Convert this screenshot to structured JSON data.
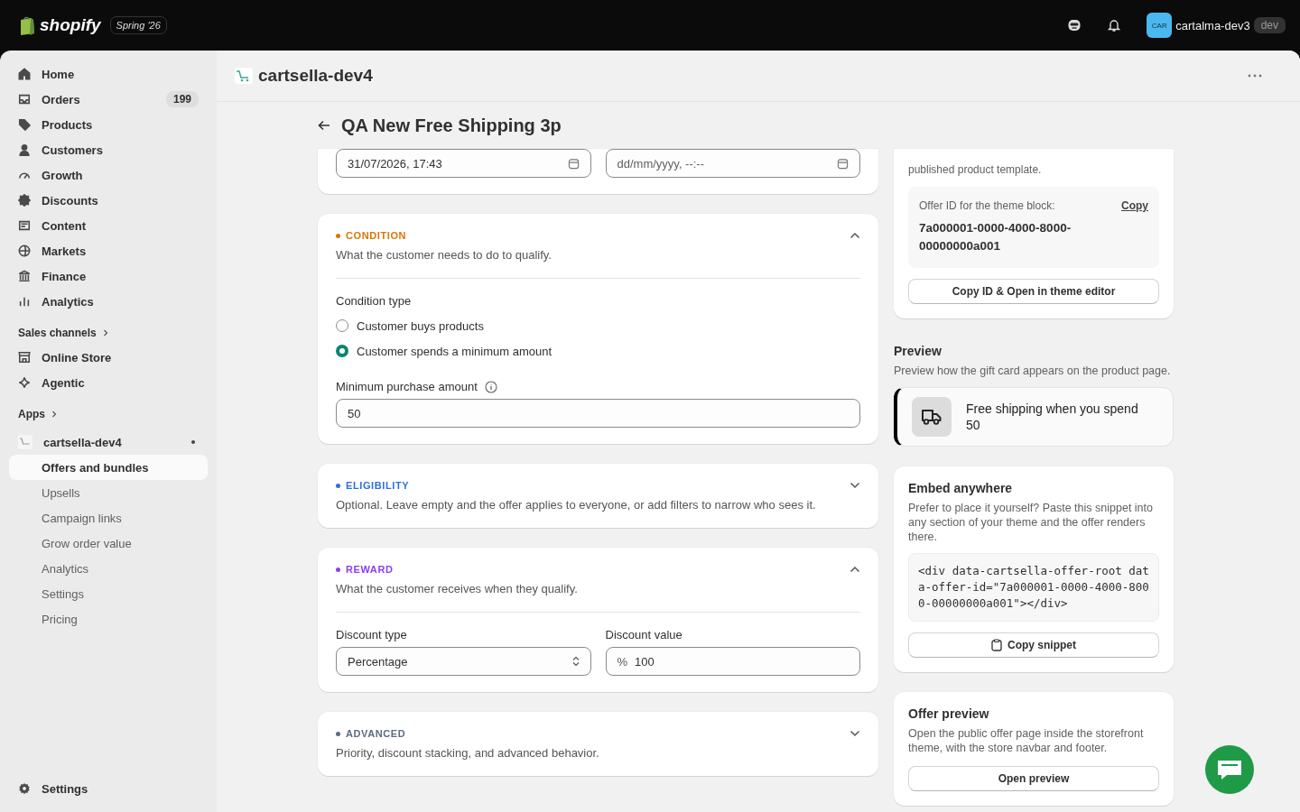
{
  "topbar": {
    "brand": "shopify",
    "edition": "Spring '26",
    "avatar": "CAR",
    "store": "cartalma-dev3",
    "store_badge": "dev"
  },
  "sidebar": {
    "items": [
      {
        "label": "Home",
        "selected": false
      },
      {
        "label": "Orders",
        "count": "199",
        "selected": false
      },
      {
        "label": "Products",
        "selected": false
      },
      {
        "label": "Customers",
        "selected": false
      },
      {
        "label": "Growth",
        "selected": false
      },
      {
        "label": "Discounts",
        "selected": false
      },
      {
        "label": "Content",
        "selected": false
      },
      {
        "label": "Markets",
        "selected": false
      },
      {
        "label": "Finance",
        "selected": false
      },
      {
        "label": "Analytics",
        "selected": false
      }
    ],
    "sales_channels": {
      "heading": "Sales channels",
      "items": [
        {
          "label": "Online Store",
          "selected": false
        },
        {
          "label": "Agentic",
          "selected": false
        }
      ]
    },
    "apps": {
      "heading": "Apps",
      "app": {
        "label": "cartsella-dev4",
        "children": [
          {
            "label": "Offers and bundles",
            "selected": true
          },
          {
            "label": "Upsells",
            "selected": false
          },
          {
            "label": "Campaign links",
            "selected": false
          },
          {
            "label": "Grow order value",
            "selected": false
          },
          {
            "label": "Analytics",
            "selected": false
          },
          {
            "label": "Settings",
            "selected": false
          },
          {
            "label": "Pricing",
            "selected": false
          }
        ]
      }
    },
    "footer": {
      "label": "Settings",
      "selected": false
    }
  },
  "app_header": {
    "title": "cartsella-dev4"
  },
  "page": {
    "title": "QA New Free Shipping 3p"
  },
  "schedule": {
    "start": "31/07/2026, 17:43",
    "end_placeholder": "dd/mm/yyyy, --:--"
  },
  "sections": [
    {
      "kind": "condition",
      "tag": "CONDITION",
      "color": "#d97706",
      "expanded": true,
      "description": "What the customer needs to do to qualify.",
      "type_label": "Condition type",
      "options": [
        {
          "label": "Customer buys products",
          "selected": false
        },
        {
          "label": "Customer spends a minimum amount",
          "selected": true
        }
      ],
      "amount_label": "Minimum purchase amount",
      "amount": "50"
    },
    {
      "kind": "eligibility",
      "tag": "ELIGIBILITY",
      "color": "#2f6fde",
      "expanded": false,
      "description": "Optional. Leave empty and the offer applies to everyone, or add filters to narrow who sees it."
    },
    {
      "kind": "reward",
      "tag": "REWARD",
      "color": "#8a3ff0",
      "expanded": true,
      "description": "What the customer receives when they qualify.",
      "type_label": "Discount type",
      "type_value": "Percentage",
      "value_label": "Discount value",
      "value_prefix": "%",
      "value": "100"
    },
    {
      "kind": "advanced",
      "tag": "ADVANCED",
      "color": "#5b6b80",
      "expanded": false,
      "description": "Priority, discount stacking, and advanced behavior."
    }
  ],
  "theme_block": {
    "note": "published product template.",
    "id_label": "Offer ID for the theme block:",
    "copy_link": "Copy",
    "offer_id": "7a000001-0000-4000-8000-00000000a001",
    "button": "Copy ID & Open in theme editor"
  },
  "preview": {
    "title": "Preview",
    "description": "Preview how the gift card appears on the product page.",
    "banner": "Free shipping when you spend 50"
  },
  "embed": {
    "title": "Embed anywhere",
    "description": "Prefer to place it yourself? Paste this snippet into any section of your theme and the offer renders there.",
    "code": "<div data-cartsella-offer-root data-offer-id=\"7a000001-0000-4000-8000-00000000a001\"></div>",
    "button": "Copy snippet"
  },
  "offer_preview": {
    "title": "Offer preview",
    "description": "Open the public offer page inside the storefront theme, with the store navbar and footer.",
    "button": "Open preview"
  }
}
